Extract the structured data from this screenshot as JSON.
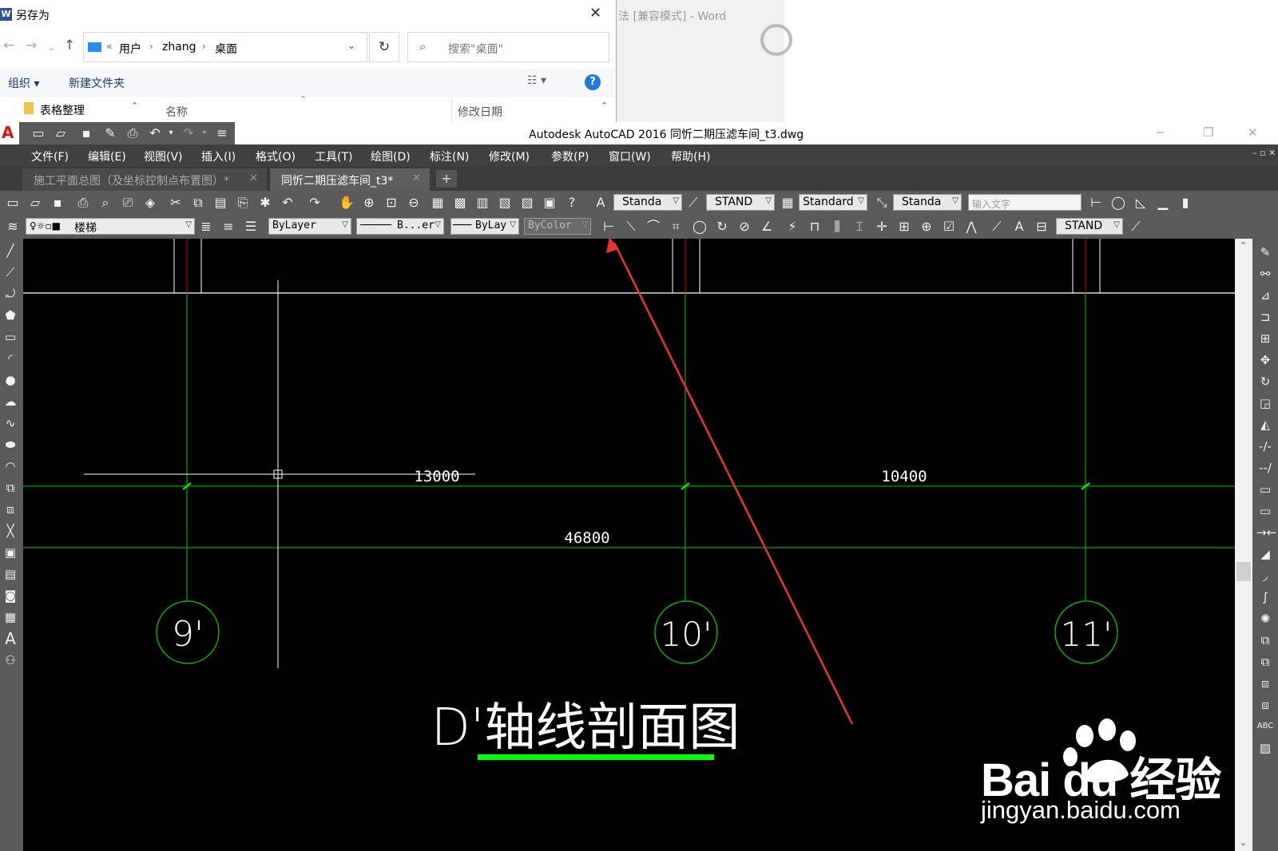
{
  "save_dialog": {
    "title": "另存为",
    "app_icon": "word-icon",
    "close_glyph": "✕",
    "path": [
      "用户",
      "zhang",
      "桌面"
    ],
    "path_prefix": "«",
    "search_placeholder": "搜索\"桌面\"",
    "organize_label": "组织 ▾",
    "new_folder_label": "新建文件夹",
    "help_label": "?",
    "folder_item": "表格整理",
    "column_name": "名称",
    "column_date": "修改日期"
  },
  "word_background": {
    "title_fragment": "法 [兼容模式] - Word"
  },
  "autocad": {
    "window_title": "Autodesk AutoCAD 2016    同忻二期压滤车间_t3.dwg",
    "menu": [
      "文件(F)",
      "编辑(E)",
      "视图(V)",
      "插入(I)",
      "格式(O)",
      "工具(T)",
      "绘图(D)",
      "标注(N)",
      "修改(M)",
      "参数(P)",
      "窗口(W)",
      "帮助(H)"
    ],
    "tabs": [
      {
        "label": "施工平面总图（及坐标控制点布置图）*",
        "active": false
      },
      {
        "label": "同忻二期压滤车间_t3*",
        "active": true
      }
    ],
    "add_tab_label": "+",
    "toolbar1": {
      "text_style": "Standa",
      "dim_style": "STAND",
      "table_style": "Standard",
      "mleader_style": "Standa",
      "text_input_placeholder": "输入文字"
    },
    "toolbar2": {
      "layer": "楼梯",
      "color": "ByLayer",
      "linetype": "B...er",
      "lineweight": "ByLay",
      "plotstyle": "ByColor",
      "dim_style2": "STAND"
    }
  },
  "drawing": {
    "dimension_1": "13000",
    "dimension_2": "10400",
    "dimension_total": "46800",
    "axis_labels": [
      "9'",
      "10'",
      "11'"
    ],
    "section_title": "D'轴线剖面图",
    "colors": {
      "axis_line": "#00cc00",
      "white_line": "#ffffff",
      "red_line": "#cc0000",
      "underline": "#00ff00",
      "annotation_arrow": "#ee3333"
    }
  },
  "watermark": {
    "brand": "Bai du 经验",
    "url": "jingyan.baidu.com"
  }
}
